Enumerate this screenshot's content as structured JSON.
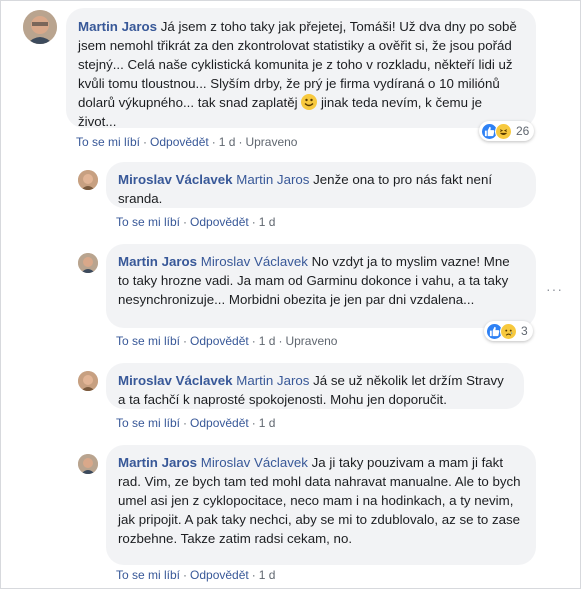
{
  "comments": [
    {
      "author": "Martin Jaros",
      "mention": "",
      "text_before_emoji": "Já jsem z toho taky jak přejetej, Tomáši! Už dva dny po sobě jsem nemohl třikrát za den zkontrolovat statistiky a ověřit si, že jsou pořád stejný... Celá naše cyklistická komunita je z toho v rozkladu, někteří lidi už kvůli tomu tloustnou... Slyším drby, že prý je firma vydíraná o 10 miliónů dolarů výkupného... tak snad zaplatěj",
      "text_after_emoji": " jinak teda nevím, k čemu je život...",
      "like_label": "To se mi líbí",
      "reply_label": "Odpovědět",
      "time": "1 d",
      "edited": "Upraveno",
      "reaction_count": "26",
      "reaction_icons": [
        "like-icon",
        "haha-icon"
      ]
    },
    {
      "author": "Miroslav Václavek",
      "mention": "Martin Jaros",
      "text": "Jenže ona to pro nás fakt není sranda.",
      "like_label": "To se mi líbí",
      "reply_label": "Odpovědět",
      "time": "1 d"
    },
    {
      "author": "Martin Jaros",
      "mention": "Miroslav Václavek",
      "text": "No vzdyt ja to myslim vazne! Mne to taky hrozne vadi. Ja mam od Garminu dokonce i vahu, a ta taky nesynchronizuje... Morbidni obezita je jen par dni vzdalena...",
      "like_label": "To se mi líbí",
      "reply_label": "Odpovědět",
      "time": "1 d",
      "edited": "Upraveno",
      "reaction_count": "3",
      "reaction_icons": [
        "like-icon",
        "sad-icon"
      ]
    },
    {
      "author": "Miroslav Václavek",
      "mention": "Martin Jaros",
      "text": "Já se už několik let držím Stravy a ta fachčí k naprosté spokojenosti. Mohu jen doporučit.",
      "like_label": "To se mi líbí",
      "reply_label": "Odpovědět",
      "time": "1 d"
    },
    {
      "author": "Martin Jaros",
      "mention": "Miroslav Václavek",
      "text": "Ja ji taky pouzivam a mam ji fakt rad. Vim, ze bych tam ted mohl data nahravat manualne. Ale to bych umel asi jen z cyklopocitace, neco mam i na hodinkach, a ty nevim, jak pripojit. A pak taky nechci, aby se mi to zdublovalo, az se to zase rozbehne. Takze zatim radsi cekam, no.",
      "like_label": "To se mi líbí",
      "reply_label": "Odpovědět",
      "time": "1 d"
    }
  ],
  "more_options": "···",
  "emoji_name": "smiley-emoji-icon",
  "colors": {
    "link": "#385898",
    "bubble": "#f2f3f5",
    "meta": "#606770",
    "like": "#2e81f4",
    "haha": "#f7c93e"
  }
}
